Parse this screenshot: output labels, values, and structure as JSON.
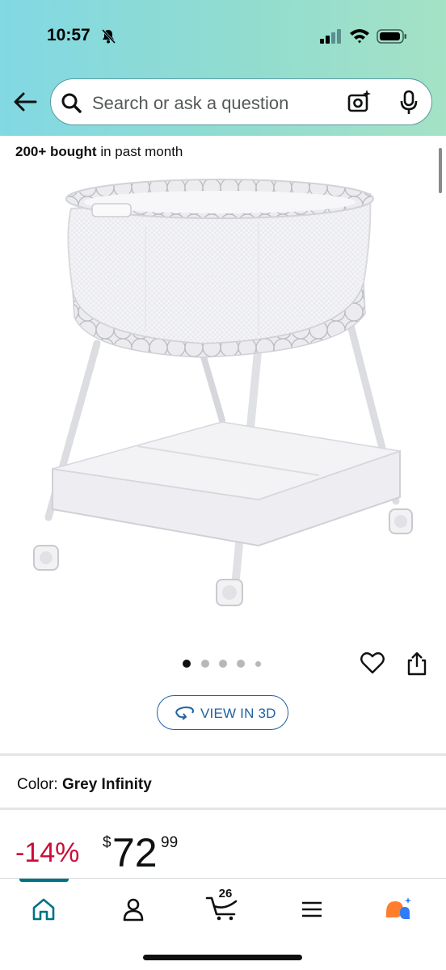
{
  "status_bar": {
    "time": "10:57"
  },
  "search": {
    "placeholder": "Search or ask a question"
  },
  "product": {
    "bought_bold": "200+ bought",
    "bought_rest": " in past month",
    "view_3d_label": "VIEW IN 3D",
    "image_count": 5,
    "active_image_index": 0,
    "color_label": "Color: ",
    "color_value": "Grey Infinity",
    "discount": "-14%",
    "price_currency": "$",
    "price_whole": "72",
    "price_fraction": "99"
  },
  "tabbar": {
    "items": [
      "home",
      "account",
      "cart",
      "menu",
      "rufus"
    ],
    "cart_count": "26",
    "active": "home"
  },
  "colors": {
    "header_accent": "#82d8e3",
    "link_blue": "#2162a1",
    "discount_red": "#cc0c39",
    "active_tab": "#007185"
  }
}
